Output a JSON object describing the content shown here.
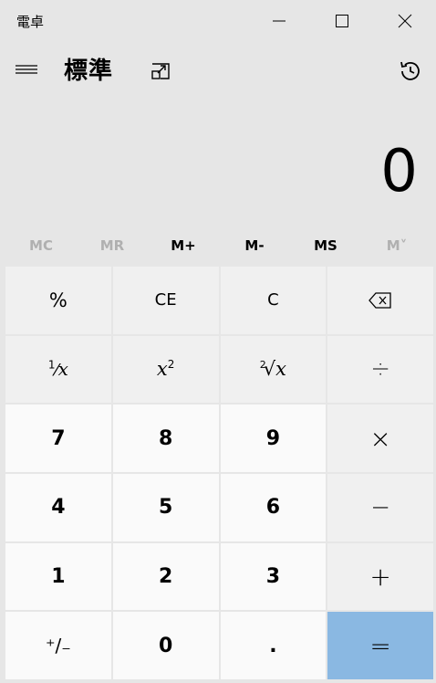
{
  "window": {
    "title": "電卓"
  },
  "header": {
    "mode_title": "標準"
  },
  "display": {
    "value": "0"
  },
  "memory": [
    {
      "label": "MC",
      "enabled": false
    },
    {
      "label": "MR",
      "enabled": false
    },
    {
      "label": "M+",
      "enabled": true
    },
    {
      "label": "M-",
      "enabled": true
    },
    {
      "label": "MS",
      "enabled": true
    },
    {
      "label": "M˅",
      "enabled": false
    }
  ],
  "keys": {
    "percent": "%",
    "clear_entry": "CE",
    "clear": "C",
    "reciprocal_num": "1",
    "reciprocal_den": "x",
    "square_base": "x",
    "square_exp": "2",
    "sqrt_index": "2",
    "sqrt_radical": "√",
    "sqrt_arg": "x",
    "divide": "÷",
    "seven": "7",
    "eight": "8",
    "nine": "9",
    "multiply": "×",
    "four": "4",
    "five": "5",
    "six": "6",
    "minus": "−",
    "one": "1",
    "two": "2",
    "three": "3",
    "plus": "+",
    "negate": "⁺/₋",
    "zero": "0",
    "decimal": ".",
    "equals": "="
  },
  "colors": {
    "background": "#e6e6e6",
    "function_key": "#f0f0f0",
    "number_key": "#fafafa",
    "equals_key": "#8ab8e2",
    "disabled_text": "#b0b0b0"
  }
}
